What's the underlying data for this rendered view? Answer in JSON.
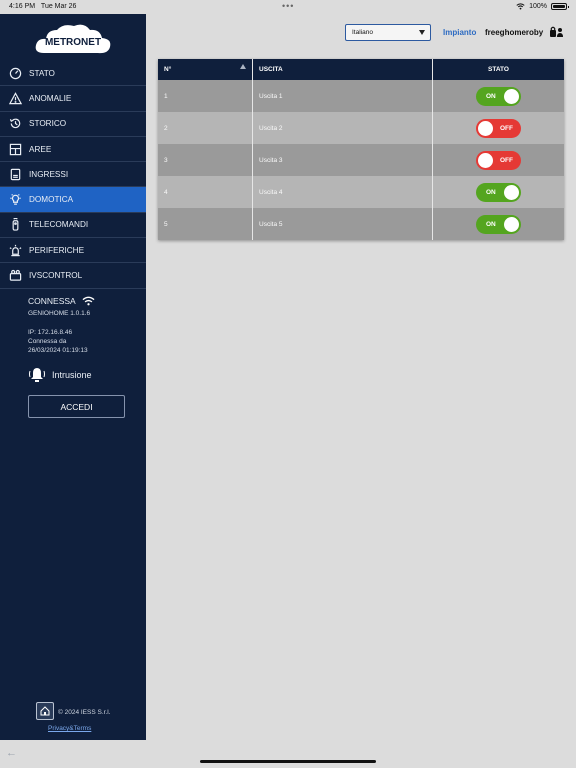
{
  "status_bar": {
    "time": "4:16 PM",
    "date": "Tue Mar 26",
    "battery": "100%"
  },
  "brand": {
    "logo_text": "METRONET"
  },
  "nav": [
    {
      "label": "STATO",
      "icon": "gauge-icon"
    },
    {
      "label": "ANOMALIE",
      "icon": "warning-icon"
    },
    {
      "label": "STORICO",
      "icon": "history-icon"
    },
    {
      "label": "AREE",
      "icon": "floorplan-icon"
    },
    {
      "label": "INGRESSI",
      "icon": "sensor-icon"
    },
    {
      "label": "DOMOTICA",
      "icon": "lightbulb-icon",
      "active": true
    },
    {
      "label": "TELECOMANDI",
      "icon": "remote-icon"
    },
    {
      "label": "PERIFERICHE",
      "icon": "siren-icon"
    },
    {
      "label": "IVSCONTROL",
      "icon": "camera-icon"
    }
  ],
  "connection": {
    "status": "CONNESSA",
    "firmware": "GENIOHOME 1.0.1.6",
    "ip": "IP: 172.16.8.46",
    "connected_since_label": "Connessa da",
    "connected_since": "26/03/2024 01:19:13"
  },
  "intrusion_label": "Intrusione",
  "login_button": "ACCEDI",
  "footer": {
    "copyright": "© 2024 IESS S.r.l.",
    "privacy": "Privacy&Terms"
  },
  "topbar": {
    "language": "Italiano",
    "impianto": "Impianto",
    "user": "freeghomeroby"
  },
  "table": {
    "headers": {
      "n": "N°",
      "uscita": "USCITA",
      "stato": "STATO"
    },
    "rows": [
      {
        "n": "1",
        "uscita": "Uscita 1",
        "stato": "ON"
      },
      {
        "n": "2",
        "uscita": "Uscita 2",
        "stato": "OFF"
      },
      {
        "n": "3",
        "uscita": "Uscita 3",
        "stato": "OFF"
      },
      {
        "n": "4",
        "uscita": "Uscita 4",
        "stato": "ON"
      },
      {
        "n": "5",
        "uscita": "Uscita 5",
        "stato": "ON"
      }
    ]
  },
  "colors": {
    "sidebar": "#0f1f3c",
    "active": "#1f63c4",
    "on": "#54a51f",
    "off": "#e53935",
    "link": "#2d6bc2"
  }
}
